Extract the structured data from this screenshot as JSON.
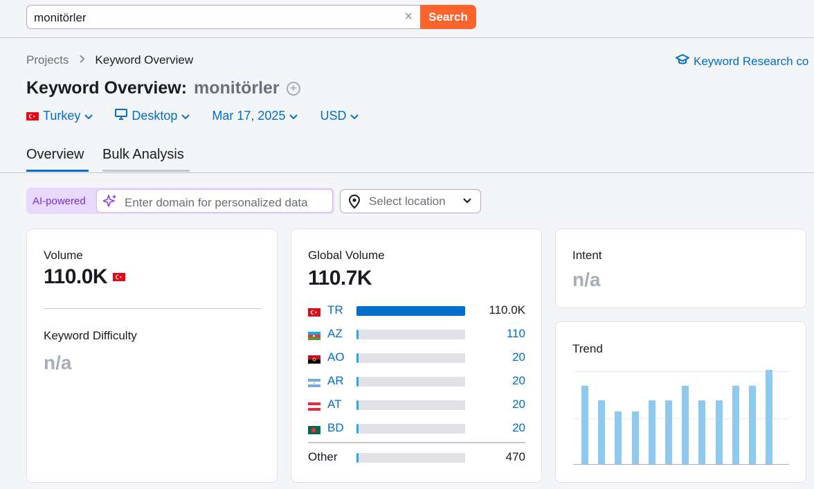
{
  "search": {
    "value": "monitörler",
    "clear_icon": "×",
    "button_label": "Search"
  },
  "breadcrumb": {
    "root": "Projects",
    "current": "Keyword Overview"
  },
  "research_link": {
    "label": "Keyword Research co"
  },
  "title": {
    "prefix": "Keyword Overview:",
    "keyword": "monitörler"
  },
  "filters": {
    "country": "Turkey",
    "device": "Desktop",
    "date": "Mar 17, 2025",
    "currency": "USD"
  },
  "tabs": {
    "overview": "Overview",
    "bulk": "Bulk Analysis"
  },
  "ai": {
    "label": "AI-powered",
    "placeholder": "Enter domain for personalized data"
  },
  "location": {
    "placeholder": "Select location"
  },
  "volume_card": {
    "volume_label": "Volume",
    "volume_value": "110.0K",
    "kd_label": "Keyword Difficulty",
    "kd_value": "n/a"
  },
  "global_card": {
    "label": "Global Volume",
    "value": "110.7K",
    "rows": [
      {
        "code": "TR",
        "value": "110.0K",
        "share": 1.0
      },
      {
        "code": "AZ",
        "value": "110",
        "share": 0.001
      },
      {
        "code": "AO",
        "value": "20",
        "share": 0.0002
      },
      {
        "code": "AR",
        "value": "20",
        "share": 0.0002
      },
      {
        "code": "AT",
        "value": "20",
        "share": 0.0002
      },
      {
        "code": "BD",
        "value": "20",
        "share": 0.0002
      }
    ],
    "other_label": "Other",
    "other_value": "470"
  },
  "intent_card": {
    "label": "Intent",
    "value": "n/a"
  },
  "trend_card": {
    "label": "Trend",
    "values": [
      0.83,
      0.68,
      0.56,
      0.56,
      0.68,
      0.68,
      0.83,
      0.68,
      0.68,
      0.83,
      0.83,
      1.0
    ]
  },
  "colors": {
    "accent": "#006dca",
    "search_button": "#ff642d",
    "ai_purple": "#7a2bd6",
    "trend_bar": "#8ec9ef"
  }
}
